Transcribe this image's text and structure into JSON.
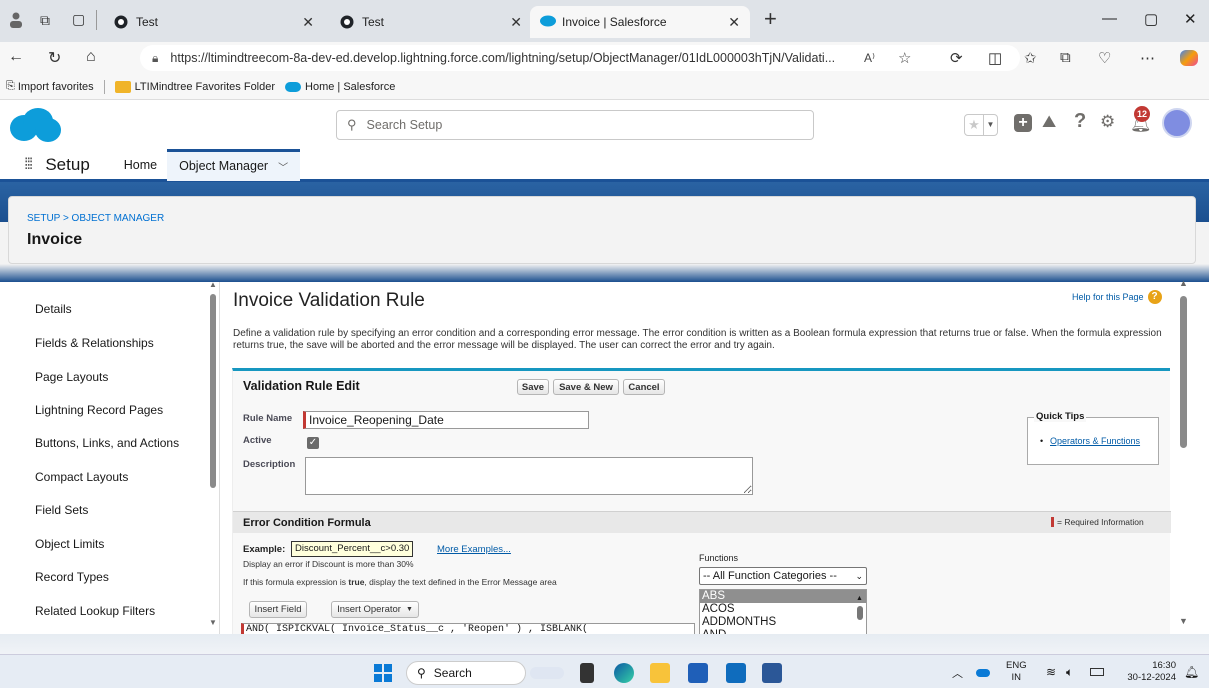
{
  "browser": {
    "tabs": [
      {
        "title": "Test"
      },
      {
        "title": "Test"
      },
      {
        "title": "Invoice | Salesforce"
      }
    ],
    "new_tab": "+",
    "url": "https://ltimindtreecom-8a-dev-ed.develop.lightning.force.com/lightning/setup/ObjectManager/01IdL000003hTjN/Validati...",
    "favorites": [
      "Import favorites",
      "LTIMindtree Favorites Folder",
      "Home | Salesforce"
    ]
  },
  "header": {
    "search_placeholder": "Search Setup",
    "notification_count": "12"
  },
  "setup_nav": {
    "app_name": "Setup",
    "home": "Home",
    "object_manager": "Object Manager"
  },
  "breadcrumb": {
    "path": "SETUP > OBJECT MANAGER",
    "title": "Invoice"
  },
  "sidebar": {
    "items": [
      "Details",
      "Fields & Relationships",
      "Page Layouts",
      "Lightning Record Pages",
      "Buttons, Links, and Actions",
      "Compact Layouts",
      "Field Sets",
      "Object Limits",
      "Record Types",
      "Related Lookup Filters"
    ]
  },
  "main": {
    "page_title": "Invoice Validation Rule",
    "help_link": "Help for this Page",
    "description": "Define a validation rule by specifying an error condition and a corresponding error message. The error condition is written as a Boolean formula expression that returns true or false. When the formula expression returns true, the save will be aborted and the error message will be displayed. The user can correct the error and try again.",
    "edit_section_title": "Validation Rule Edit",
    "buttons": {
      "save": "Save",
      "save_new": "Save & New",
      "cancel": "Cancel"
    },
    "rule_name_label": "Rule Name",
    "rule_name_value": "Invoice_Reopening_Date",
    "active_label": "Active",
    "active_checked": true,
    "description_label": "Description",
    "description_value": "",
    "quick_tips_title": "Quick Tips",
    "quick_tips_link": "Operators & Functions",
    "error_section_title": "Error Condition Formula",
    "required_info": "= Required Information",
    "example_label": "Example:",
    "example_value": "Discount_Percent__c>0.30",
    "more_examples": "More Examples...",
    "example_desc": "Display an error if Discount is more than 30%",
    "formula_hint_pre": "If this formula expression is ",
    "formula_hint_bold": "true",
    "formula_hint_post": ", display the text defined in the Error Message area",
    "insert_field": "Insert Field",
    "insert_operator": "Insert Operator",
    "formula_text": "AND( ISPICKVAL( Invoice_Status__c , 'Reopen' ) , ISBLANK(",
    "functions_label": "Functions",
    "functions_category": "-- All Function Categories --",
    "functions_list": [
      "ABS",
      "ACOS",
      "ADDMONTHS",
      "AND"
    ]
  },
  "taskbar": {
    "search": "Search",
    "lang": "ENG",
    "region": "IN",
    "time": "16:30",
    "date": "30-12-2024"
  },
  "colors": {
    "sf_blue": "#1b5297",
    "accent_cyan": "#1797c0",
    "required_red": "#c23934",
    "link_blue": "#015ba7"
  }
}
